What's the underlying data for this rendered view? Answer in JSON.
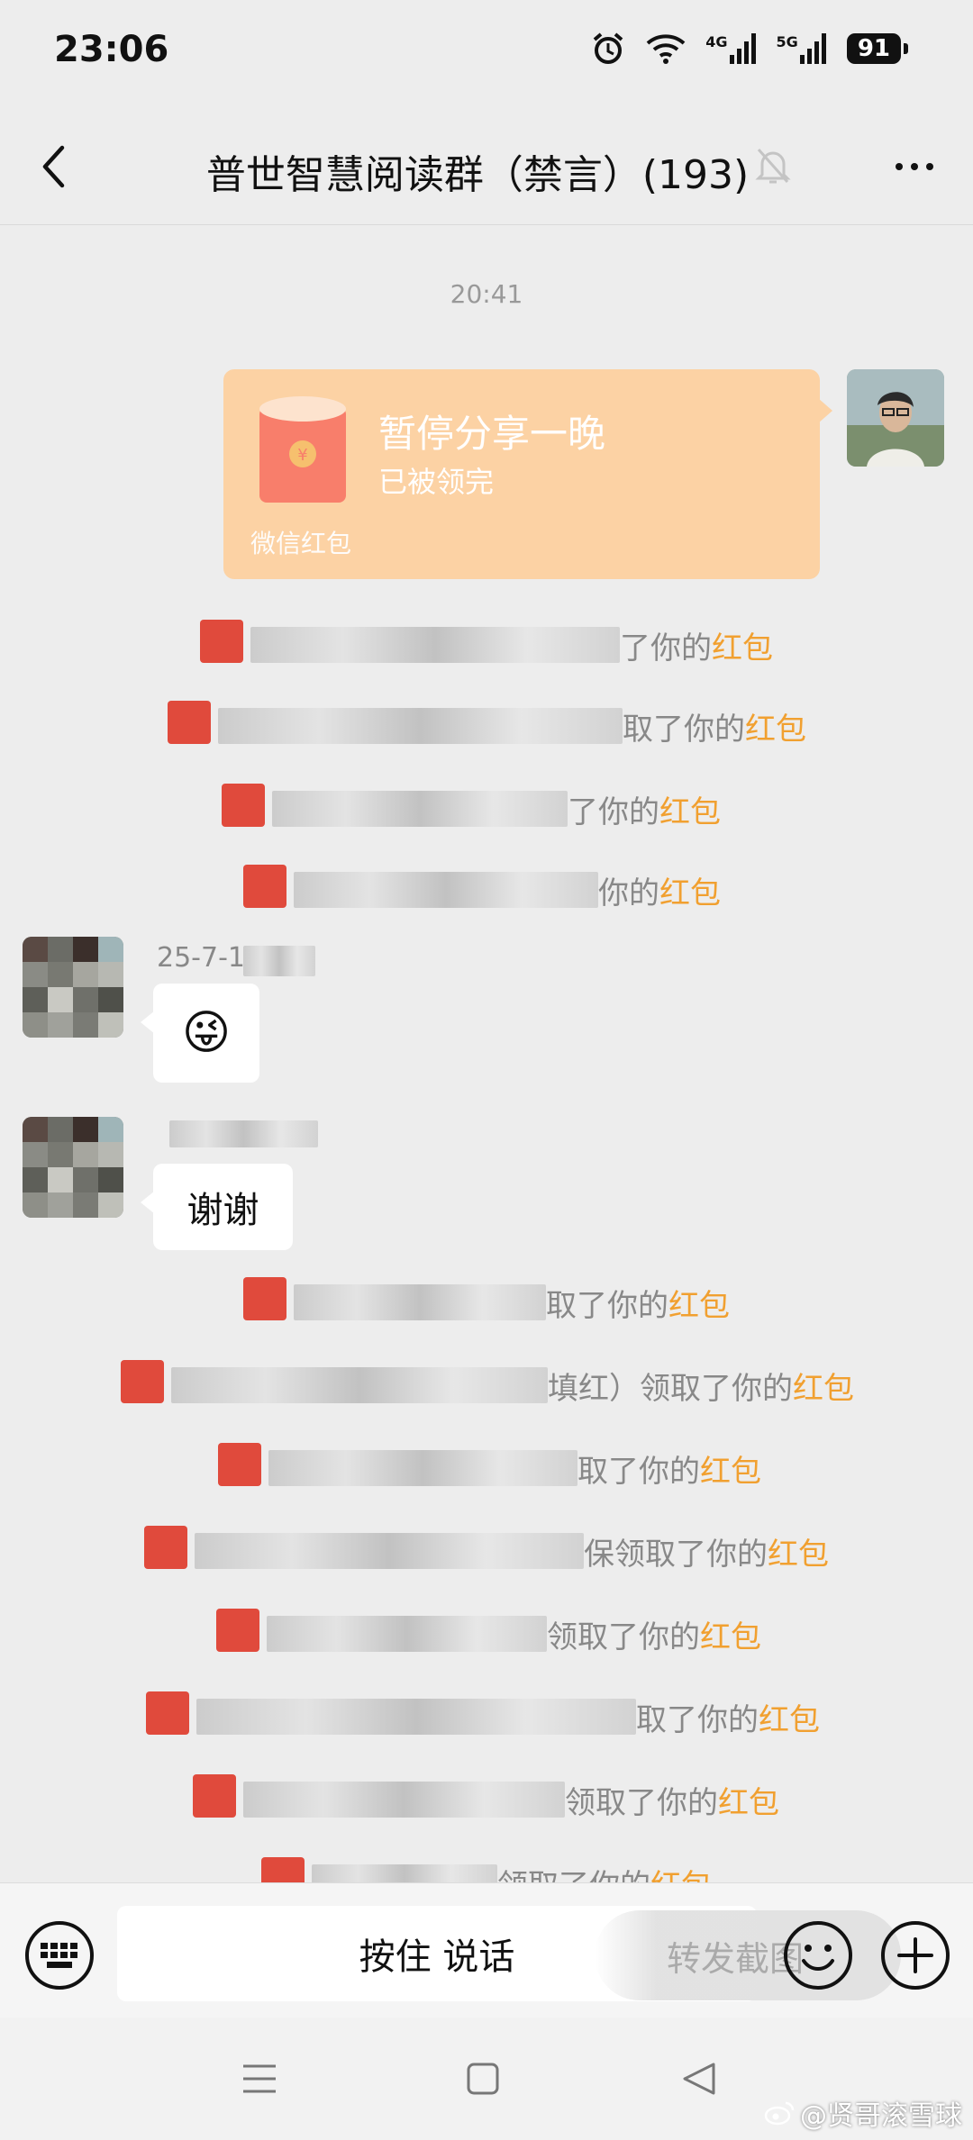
{
  "status_bar": {
    "time": "23:06",
    "network_1": "4G",
    "network_2": "5G",
    "battery": "91",
    "icons": [
      "alarm-icon",
      "wifi-icon",
      "signal-icon",
      "signal-icon",
      "battery-icon"
    ]
  },
  "nav": {
    "title": "普世智慧阅读群（禁言）(193)",
    "back_icon": "chevron-left-icon",
    "mute_icon": "bell-muted-icon",
    "more_icon": "more-icon"
  },
  "chat": {
    "timestamp": "20:41",
    "red_packet": {
      "title": "暂停分享一晚",
      "status": "已被领完",
      "footer": "微信红包",
      "icon": "red-packet-icon",
      "accent": "#fcd2a4"
    },
    "notices": [
      {
        "text": "了你的",
        "link": "红包"
      },
      {
        "text": "取了你的",
        "link": "红包"
      },
      {
        "text": "了你的",
        "link": "红包"
      },
      {
        "text": "你的",
        "link": "红包"
      },
      {
        "text": "取了你的",
        "link": "红包"
      },
      {
        "text": "填红）领取了你的",
        "link": "红包"
      },
      {
        "text": "取了你的",
        "link": "红包"
      },
      {
        "text": "保领取了你的",
        "link": "红包"
      },
      {
        "text": "领取了你的",
        "link": "红包"
      },
      {
        "text": "取了你的",
        "link": "红包"
      },
      {
        "text": "领取了你的",
        "link": "红包"
      },
      {
        "text": "领取了你的",
        "link": "红包"
      }
    ],
    "message_1": {
      "sender": "25-7-1",
      "content": "😜"
    },
    "message_2": {
      "sender": "",
      "content": "谢谢"
    },
    "link_color": "#f1a030"
  },
  "input_bar": {
    "hold_to_talk": "按住 说话",
    "forward_overlay": "转发截图",
    "keyboard_icon": "keyboard-icon",
    "emoji_icon": "emoji-icon",
    "plus_icon": "plus-icon"
  },
  "system_nav": {
    "icons": [
      "menu-icon",
      "home-square-icon",
      "back-triangle-icon"
    ]
  },
  "watermark": "@贤哥滚雪球"
}
